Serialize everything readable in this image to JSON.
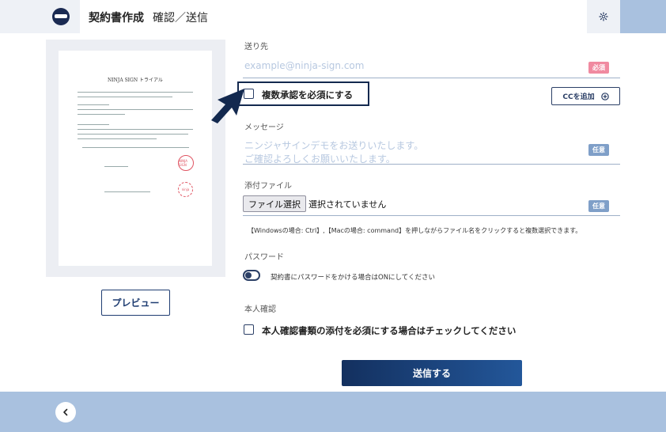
{
  "header": {
    "title": "契約書作成",
    "subtitle": "確認／送信"
  },
  "preview": {
    "doc_title": "NINJA SIGN トライアル",
    "stamp1": "NINJA SIGN",
    "stamp2": "ninja",
    "button_label": "プレビュー"
  },
  "recipient": {
    "label": "送り先",
    "email_placeholder": "example@ninja-sign.com",
    "required_badge": "必須",
    "multi_approval_label": "複数承認を必須にする",
    "cc_button_label": "CCを追加"
  },
  "message": {
    "label": "メッセージ",
    "placeholder_line1": "ニンジャサインデモをお送りいたします。",
    "placeholder_line2": "ご確認よろしくお願いいたします。",
    "optional_badge": "任意"
  },
  "attachment": {
    "label": "添付ファイル",
    "file_button_label": "ファイル選択",
    "file_status": "選択されていません",
    "optional_badge": "任意",
    "hint": "【Windowsの場合: Ctrl】,【Macの場合: command】を押しながらファイル名をクリックすると複数選択できます。"
  },
  "password": {
    "label": "パスワード",
    "toggle_label": "契約書にパスワードをかける場合はONにしてください",
    "toggle_on": false
  },
  "identity": {
    "label": "本人確認",
    "checkbox_label": "本人確認書類の添付を必須にする場合はチェックしてください"
  },
  "send_button_label": "送信する",
  "colors": {
    "navy": "#13294f",
    "accent_blue": "#23579a",
    "band_blue": "#a9c1df",
    "required_pink": "#f08aa0",
    "optional_blue": "#7f9fc8"
  },
  "icons": {
    "logo": "ninja-logo-icon",
    "settings": "gear-icon",
    "add": "plus-circle-icon",
    "back": "chevron-left-icon",
    "pointer": "arrow-pointer-icon"
  }
}
